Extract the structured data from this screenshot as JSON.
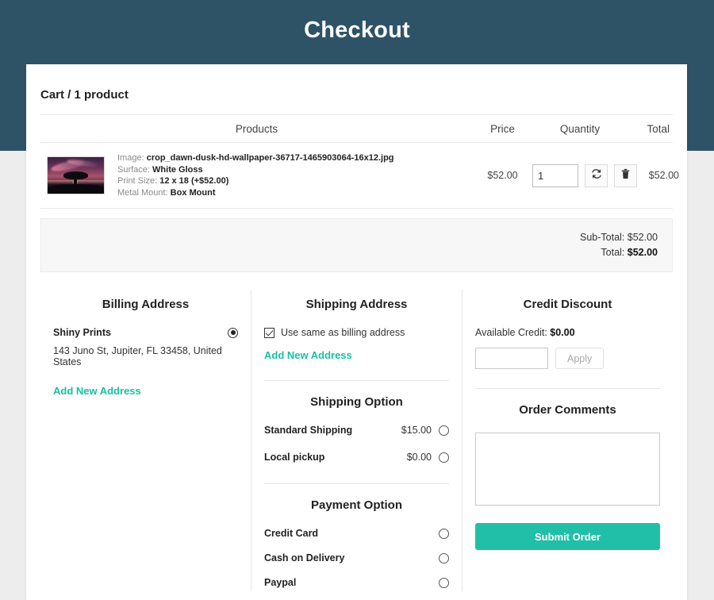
{
  "page": {
    "title": "Checkout"
  },
  "colors": {
    "header_bg": "#2e5367",
    "accent_teal": "#22bfa8",
    "link_teal": "#17bfa4",
    "page_bg": "#ededed"
  },
  "cart": {
    "heading": "Cart / 1 product",
    "columns": {
      "products": "Products",
      "price": "Price",
      "quantity": "Quantity",
      "total": "Total"
    },
    "item": {
      "thumbnail_alt": "dawn-dusk-landscape-thumbnail",
      "fields": [
        {
          "label": "Image:",
          "value": "crop_dawn-dusk-hd-wallpaper-36717-1465903064-16x12.jpg"
        },
        {
          "label": "Surface:",
          "value": "White Gloss"
        },
        {
          "label": "Print Size:",
          "value": "12 x 18 (+$52.00)"
        },
        {
          "label": "Metal Mount:",
          "value": "Box Mount"
        }
      ],
      "price": "$52.00",
      "quantity": "1",
      "total": "$52.00",
      "update_icon": "refresh-icon",
      "delete_icon": "trash-icon"
    },
    "totals": {
      "subtotal_label": "Sub-Total:",
      "subtotal_value": "$52.00",
      "total_label": "Total:",
      "total_value": "$52.00"
    }
  },
  "billing": {
    "title": "Billing Address",
    "name": "Shiny Prints",
    "address": "143 Juno St, Jupiter, FL 33458, United States",
    "selected": true,
    "add_new_label": "Add New Address"
  },
  "shipping": {
    "title": "Shipping Address",
    "same_as_billing_label": "Use same as billing address",
    "same_as_billing_checked": true,
    "add_new_label": "Add New Address",
    "option_title": "Shipping Option",
    "options": [
      {
        "label": "Standard Shipping",
        "price": "$15.00",
        "selected": false
      },
      {
        "label": "Local pickup",
        "price": "$0.00",
        "selected": false
      }
    ]
  },
  "payment": {
    "title": "Payment Option",
    "options": [
      {
        "label": "Credit Card",
        "selected": false
      },
      {
        "label": "Cash on Delivery",
        "selected": false
      },
      {
        "label": "Paypal",
        "selected": false
      }
    ]
  },
  "credit": {
    "title": "Credit Discount",
    "available_label": "Available Credit:",
    "available_value": "$0.00",
    "input_value": "",
    "input_placeholder": "",
    "apply_label": "Apply",
    "apply_disabled": true
  },
  "comments": {
    "title": "Order Comments",
    "value": "",
    "placeholder": "",
    "submit_label": "Submit Order"
  }
}
